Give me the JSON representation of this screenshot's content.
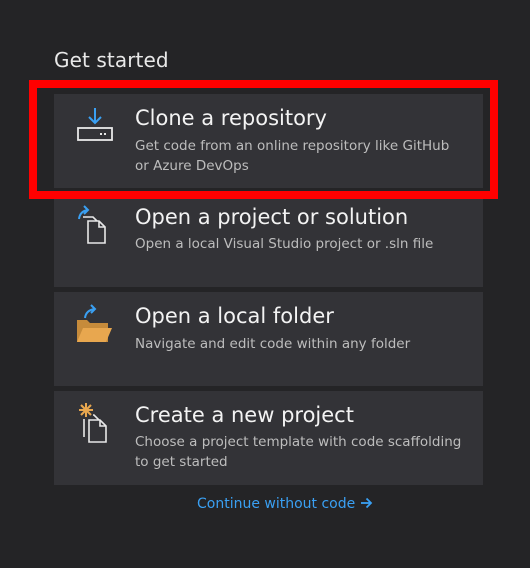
{
  "section_title": "Get started",
  "cards": [
    {
      "title": "Clone a repository",
      "description": "Get code from an online repository like GitHub or Azure DevOps",
      "icon": "clone-download-icon"
    },
    {
      "title": "Open a project or solution",
      "description": "Open a local Visual Studio project or .sln file",
      "icon": "open-project-icon"
    },
    {
      "title": "Open a local folder",
      "description": "Navigate and edit code within any folder",
      "icon": "folder-open-icon"
    },
    {
      "title": "Create a new project",
      "description": "Choose a project template with code scaffolding to get started",
      "icon": "new-project-icon"
    }
  ],
  "continue_link": "Continue without code",
  "colors": {
    "background": "#242426",
    "card": "#333337",
    "link": "#3aa0f3",
    "highlight": "#ff0000",
    "icon_accent_blue": "#3aa0f3",
    "folder_orange": "#e8a74f"
  }
}
